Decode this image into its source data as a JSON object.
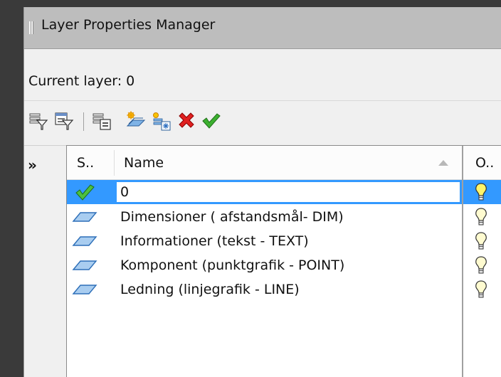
{
  "window": {
    "title": "Layer Properties Manager"
  },
  "current_layer_text": "Current layer: 0",
  "toolbar": {
    "items": [
      {
        "icon": "new-property-filter-icon"
      },
      {
        "icon": "new-group-filter-icon"
      },
      {
        "icon": "layer-states-manager-icon"
      },
      {
        "icon": "new-layer-icon"
      },
      {
        "icon": "new-layer-vp-frozen-icon"
      },
      {
        "icon": "delete-layer-icon"
      },
      {
        "icon": "set-current-icon"
      }
    ]
  },
  "side_toggle": "»",
  "table": {
    "columns": [
      {
        "key": "status",
        "label": "S.."
      },
      {
        "key": "name",
        "label": "Name"
      },
      {
        "key": "on",
        "label": "O.."
      }
    ],
    "rows": [
      {
        "name": "0",
        "status": "current",
        "on": "on"
      },
      {
        "name": "Dimensioner ( afstandsmål- DIM)",
        "status": "layer",
        "on": "on"
      },
      {
        "name": "Informationer (tekst - TEXT)",
        "status": "layer",
        "on": "on"
      },
      {
        "name": "Komponent (punktgrafik - POINT)",
        "status": "layer",
        "on": "on"
      },
      {
        "name": "Ledning (linjegrafik - LINE)",
        "status": "layer",
        "on": "on"
      }
    ]
  },
  "colors": {
    "selection": "#3399ff",
    "titlebar": "#bdbdbd",
    "panel": "#f0f0f0"
  }
}
